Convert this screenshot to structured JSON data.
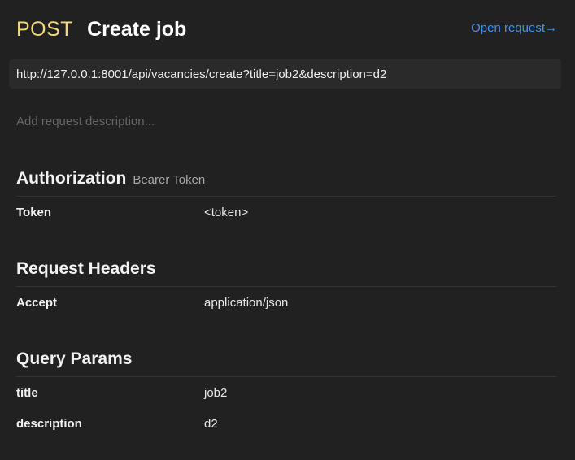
{
  "header": {
    "method": "POST",
    "title": "Create job",
    "open_link": "Open request→"
  },
  "url": "http://127.0.0.1:8001/api/vacancies/create?title=job2&description=d2",
  "description_placeholder": "Add request description...",
  "authorization": {
    "title": "Authorization",
    "type": "Bearer Token",
    "rows": [
      {
        "key": "Token",
        "value": "<token>"
      }
    ]
  },
  "headers": {
    "title": "Request Headers",
    "rows": [
      {
        "key": "Accept",
        "value": "application/json"
      }
    ]
  },
  "query": {
    "title": "Query Params",
    "rows": [
      {
        "key": "title",
        "value": "job2"
      },
      {
        "key": "description",
        "value": "d2"
      }
    ]
  }
}
